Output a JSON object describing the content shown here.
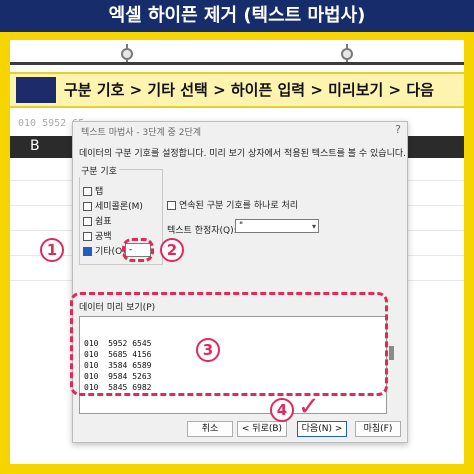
{
  "banner": {
    "title": "엑셀 하이픈 제거 (텍스트 마법사)"
  },
  "steps": {
    "text": "구분 기호 > 기타 선택 > 하이픈 입력 > 미리보기 > 다음"
  },
  "sheet": {
    "row1_fragment": "010 5952 65",
    "column_header": "B"
  },
  "dialog": {
    "title": "텍스트 마법사 - 3단계 중 2단계",
    "close": "?",
    "description": "데이터의 구분 기호를 설정합니다. 미리 보기 상자에서 적용된 텍스트를 볼 수 있습니다.",
    "delimiters": {
      "group_title": "구분 기호",
      "tab": "탭",
      "semicolon": "세미콜론(M)",
      "comma": "쉼표",
      "space": "공백",
      "other": "기타(O):",
      "other_value": "-"
    },
    "merge_label": "연속된 구분 기호를 하나로 처리",
    "qualifier_label": "텍스트 한정자(Q):",
    "qualifier_value": "\"",
    "preview_label": "데이터 미리 보기(P)",
    "preview_rows": [
      [
        "010",
        "5952",
        "6545"
      ],
      [
        "010",
        "5685",
        "4156"
      ],
      [
        "010",
        "3584",
        "6589"
      ],
      [
        "010",
        "9584",
        "5263"
      ],
      [
        "010",
        "5845",
        "6982"
      ]
    ],
    "buttons": {
      "cancel": "취소",
      "back": "< 뒤로(B)",
      "next": "다음(N) >",
      "finish": "마침(F)"
    }
  },
  "annotations": {
    "n1": "1",
    "n2": "2",
    "n3": "3",
    "n4": "4",
    "checkmark": "✓"
  },
  "colors": {
    "banner": "#162c6b",
    "frame": "#f5d400",
    "annotation": "#e02a5a",
    "checked": "#1f5fbf"
  }
}
